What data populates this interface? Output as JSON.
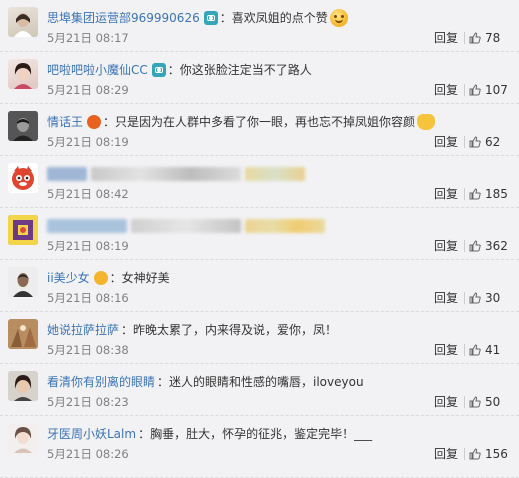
{
  "reply_label": "回复",
  "comments": [
    {
      "user": "思埠集团运营部969990626",
      "text": "：喜欢凤姐的点个赞",
      "time": "5月21日 08:17",
      "likes": "78",
      "blurred": false
    },
    {
      "user": "吧啦吧啦小魔仙CC",
      "text": "：你这张脸注定当不了路人",
      "time": "5月21日 08:29",
      "likes": "107",
      "blurred": false
    },
    {
      "user": "情话王",
      "text": "：只是因为在人群中多看了你一眼，再也忘不掉凤姐你容颜",
      "time": "5月21日 08:19",
      "likes": "62",
      "blurred": false
    },
    {
      "user": "",
      "text": "",
      "time": "5月21日 08:42",
      "likes": "185",
      "blurred": true
    },
    {
      "user": "",
      "text": "",
      "time": "5月21日 08:19",
      "likes": "362",
      "blurred": true
    },
    {
      "user": "ii美少女",
      "text": "：女神好美",
      "time": "5月21日 08:16",
      "likes": "30",
      "blurred": false
    },
    {
      "user": "她说拉萨拉萨",
      "text": "：昨晚太累了，内来得及说，爱你，凤！",
      "time": "5月21日 08:38",
      "likes": "41",
      "blurred": false
    },
    {
      "user": "看清你有别离的眼睛",
      "text": "：迷人的眼睛和性感的嘴唇，iloveyou",
      "time": "5月21日 08:23",
      "likes": "50",
      "blurred": false
    },
    {
      "user": "牙医周小妖Lalm",
      "text": "：胸垂，肚大，怀孕的征兆，鉴定完毕！___",
      "time": "5月21日 08:26",
      "likes": "156",
      "blurred": false
    }
  ]
}
